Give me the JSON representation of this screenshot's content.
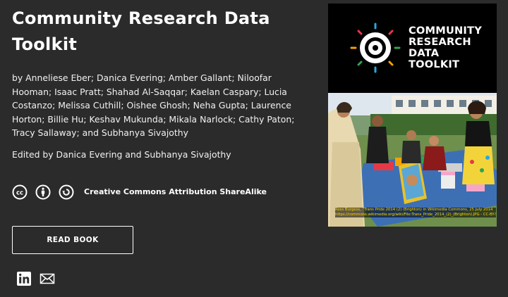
{
  "book": {
    "title": "Community Research Data Toolkit",
    "authors": "by Anneliese Eber; Danica Evering; Amber Gallant; Niloofar Hooman; Isaac Pratt; Shahad Al-Saqqar; Kaelan Caspary; Lucia Costanzo; Melissa Cuthill; Oishee Ghosh; Neha Gupta; Laurence Horton; Billie Hu; Keshav Mukunda; Mikala Narlock; Cathy Paton; Tracy Sallaway; and Subhanya Sivajothy",
    "editors": "Edited by Danica Evering and Subhanya Sivajothy",
    "license": "Creative Commons Attribution ShareAlike",
    "read_button": "READ BOOK"
  },
  "license_icons": [
    "cc-icon",
    "attribution-icon",
    "sharealike-icon"
  ],
  "social": [
    "linkedin-icon",
    "email-icon"
  ],
  "cover": {
    "logo_lines": [
      "COMMUNITY",
      "RESEARCH",
      "DATA",
      "TOOLKIT"
    ],
    "caption_line1": "Ross Burgess, \"Trans Pride 2014 (2) (Brighton) in Wikimedia Commons, 25 July 2014",
    "caption_line2": "https://commons.wikimedia.org/wiki/File:Trans_Pride_2014_(2)_(Brighton).JPG - CC-BY-SA 4.0"
  },
  "colors": {
    "background": "#2b2b2b",
    "text": "#ffffff",
    "caption": "#ffd700"
  }
}
